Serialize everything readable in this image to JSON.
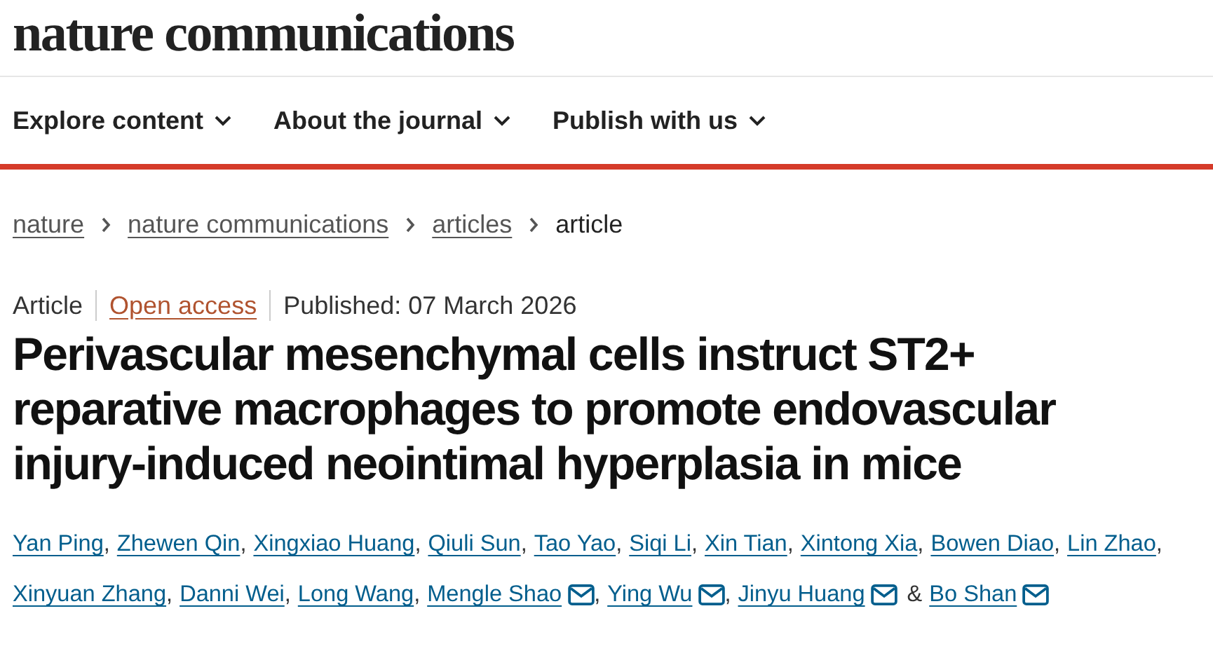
{
  "logo": "nature communications",
  "nav": [
    {
      "label": "Explore content"
    },
    {
      "label": "About the journal"
    },
    {
      "label": "Publish with us"
    }
  ],
  "breadcrumb": [
    {
      "label": "nature",
      "link": true
    },
    {
      "label": "nature communications",
      "link": true
    },
    {
      "label": "articles",
      "link": true
    },
    {
      "label": "article",
      "link": false
    }
  ],
  "meta": {
    "type": "Article",
    "access": "Open access",
    "published": "Published: 07 March 2026"
  },
  "title": "Perivascular mesenchymal cells instruct ST2+ reparative macrophages to promote endovascular injury-induced neointimal hyperplasia in mice",
  "authors": [
    {
      "name": "Yan Ping",
      "email": false,
      "sep": ","
    },
    {
      "name": "Zhewen Qin",
      "email": false,
      "sep": ","
    },
    {
      "name": "Xingxiao Huang",
      "email": false,
      "sep": ","
    },
    {
      "name": "Qiuli Sun",
      "email": false,
      "sep": ","
    },
    {
      "name": "Tao Yao",
      "email": false,
      "sep": ","
    },
    {
      "name": "Siqi Li",
      "email": false,
      "sep": ","
    },
    {
      "name": "Xin Tian",
      "email": false,
      "sep": ","
    },
    {
      "name": "Xintong Xia",
      "email": false,
      "sep": ","
    },
    {
      "name": "Bowen Diao",
      "email": false,
      "sep": ","
    },
    {
      "name": "Lin Zhao",
      "email": false,
      "sep": ","
    },
    {
      "name": "Xinyuan Zhang",
      "email": false,
      "sep": ","
    },
    {
      "name": "Danni Wei",
      "email": false,
      "sep": ","
    },
    {
      "name": "Long Wang",
      "email": false,
      "sep": ","
    },
    {
      "name": "Mengle Shao",
      "email": true,
      "sep": ","
    },
    {
      "name": "Ying Wu",
      "email": true,
      "sep": ","
    },
    {
      "name": "Jinyu Huang",
      "email": true,
      "sep": "&"
    },
    {
      "name": "Bo Shan",
      "email": true
    }
  ]
}
